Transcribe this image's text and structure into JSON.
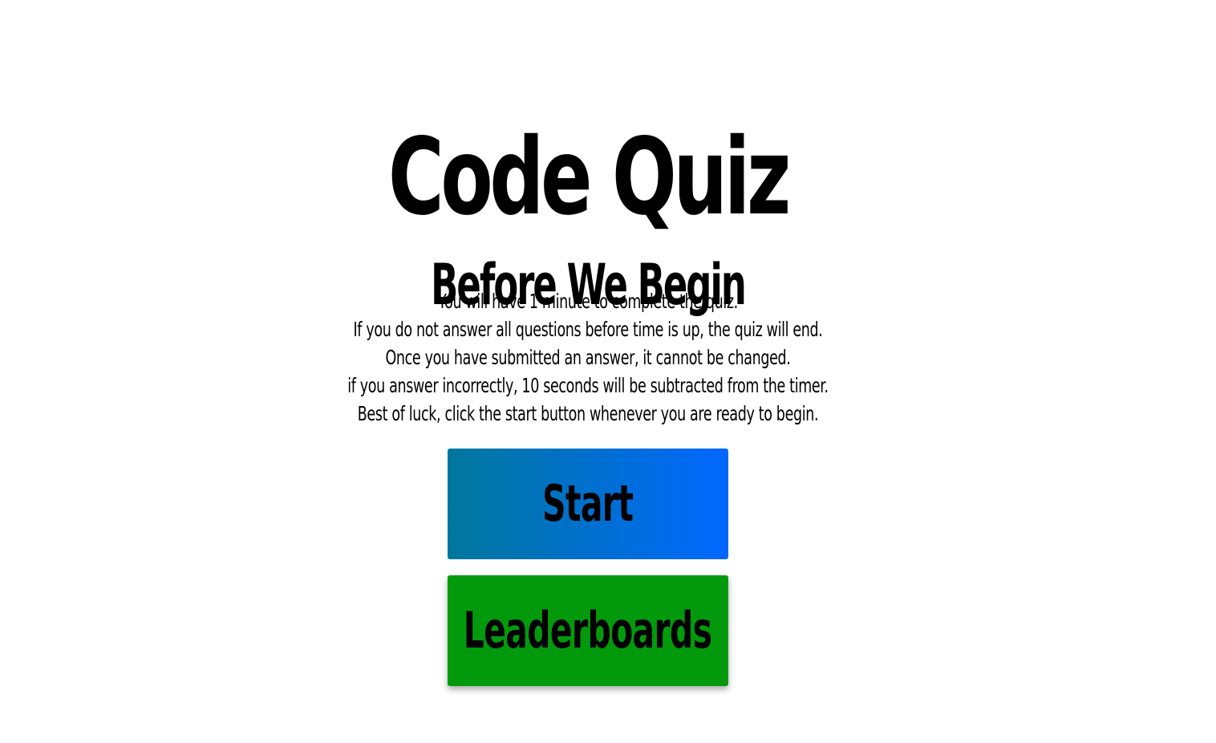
{
  "header": {
    "title": "Code Quiz"
  },
  "intro": {
    "heading": "Before We Begin",
    "rules": [
      "You will have 1 minute to complete the quiz.",
      "If you do not answer all questions before time is up, the quiz will end.",
      "Once you have submitted an answer, it cannot be changed.",
      "if you answer incorrectly, 10 seconds will be subtracted from the timer.",
      "Best of luck, click the start button whenever you are ready to begin."
    ]
  },
  "actions": {
    "start_label": "Start",
    "leaderboards_label": "Leaderboards"
  },
  "colors": {
    "start_gradient_left": "#00779c",
    "start_gradient_right": "#0068ff",
    "leaderboards_bg": "#029a0c"
  }
}
